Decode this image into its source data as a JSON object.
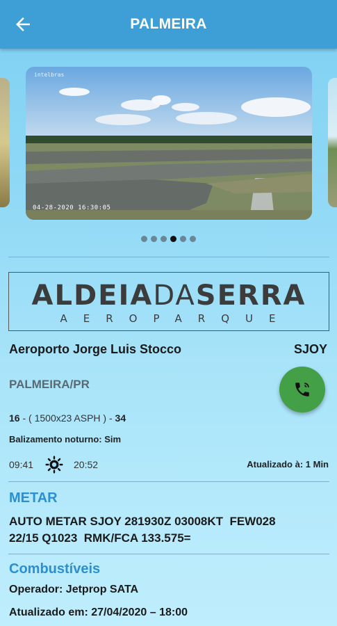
{
  "appbar": {
    "title": "PALMEIRA",
    "back_icon": "arrow-left-icon"
  },
  "camera": {
    "watermark": "intelbras",
    "timestamp": "04-28-2020  16:30:05",
    "dots_total": 6,
    "active_index": 3
  },
  "logo": {
    "line1_bold_a": "ALDEIA",
    "line1_light": "DA",
    "line1_bold_b": "SERRA",
    "line2": "AEROPARQUE"
  },
  "airport": {
    "name": "Aeroporto Jorge Luis Stocco",
    "icao": "SJOY",
    "city": "PALMEIRA/PR"
  },
  "runway": {
    "head_a": "16",
    "sep_a": " - ",
    "spec": "( 1500x23 ASPH )",
    "sep_b": " - ",
    "head_b": "34"
  },
  "lighting": "Balizamento noturno: Sim",
  "sun": {
    "sunrise": "09:41",
    "sunset": "20:52",
    "icon": "sun-icon"
  },
  "updated": "Atualizado à: 1 Min",
  "metar": {
    "title": "METAR",
    "text": "AUTO METAR SJOY 281930Z 03008KT  FEW028\n22/15 Q1023  RMK/FCA 133.575="
  },
  "fuel": {
    "title": "Combustíveis",
    "operator": "Operador: Jetprop SATA",
    "updated": "Atualizado em: 27/04/2020 – 18:00"
  },
  "colors": {
    "appbar": "#3d9fd5",
    "accent": "#2b8fd0",
    "call_button": "#43a047"
  }
}
